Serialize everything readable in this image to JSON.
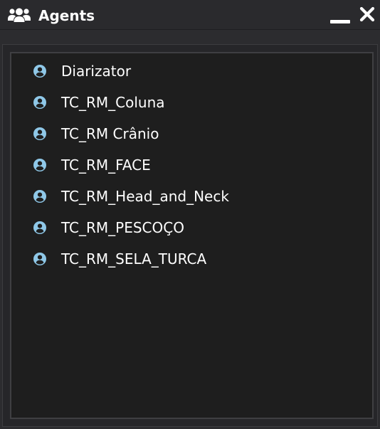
{
  "window": {
    "title": "Agents",
    "title_icon": "users-icon",
    "minimize_icon": "minimize-icon",
    "close_icon": "close-icon"
  },
  "colors": {
    "user_icon": "#8fc8e8",
    "text": "#ffffff",
    "list_background": "#1e1e1e",
    "window_background": "#2c2c2f"
  },
  "agents": {
    "items": [
      {
        "label": "Diarizator",
        "icon": "user-circle-icon"
      },
      {
        "label": "TC_RM_Coluna",
        "icon": "user-circle-icon"
      },
      {
        "label": "TC_RM Crânio",
        "icon": "user-circle-icon"
      },
      {
        "label": "TC_RM_FACE",
        "icon": "user-circle-icon"
      },
      {
        "label": "TC_RM_Head_and_Neck",
        "icon": "user-circle-icon"
      },
      {
        "label": "TC_RM_PESCOÇO",
        "icon": "user-circle-icon"
      },
      {
        "label": "TC_RM_SELA_TURCA",
        "icon": "user-circle-icon"
      }
    ]
  }
}
